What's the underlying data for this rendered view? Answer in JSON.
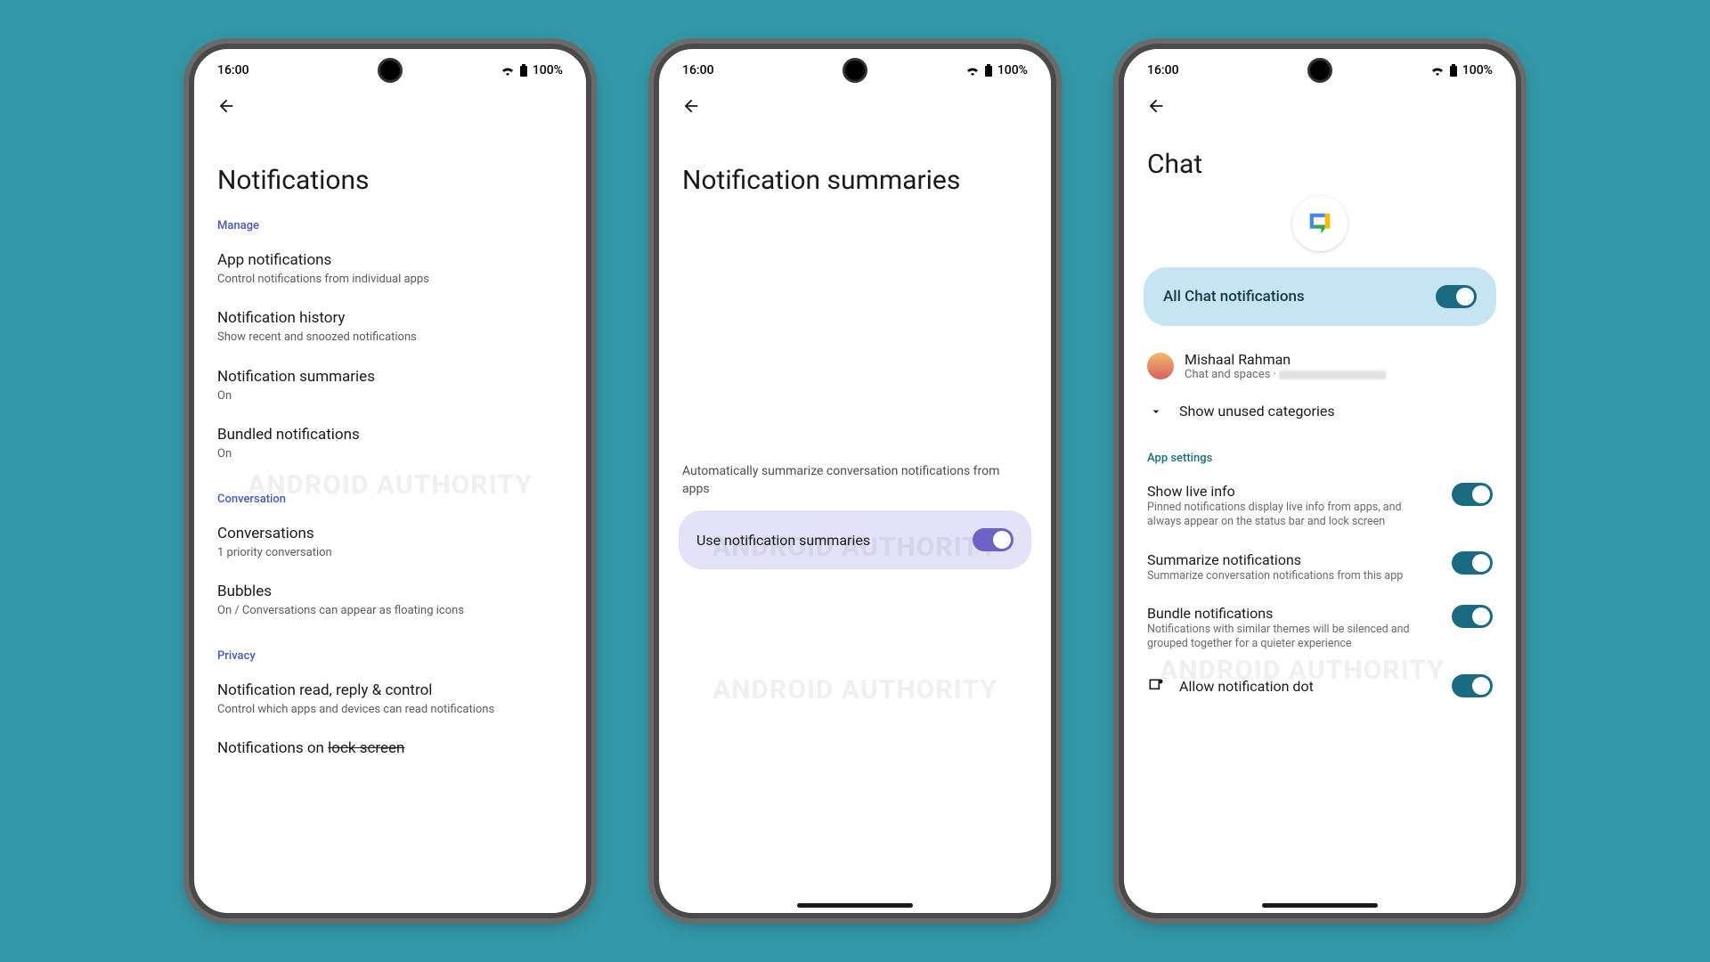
{
  "status": {
    "time": "16:00",
    "battery": "100%"
  },
  "watermark": "ANDROID AUTHORITY",
  "screen1": {
    "title": "Notifications",
    "manage_hdr": "Manage",
    "app_notif": {
      "t": "App notifications",
      "s": "Control notifications from individual apps"
    },
    "history": {
      "t": "Notification history",
      "s": "Show recent and snoozed notifications"
    },
    "summaries": {
      "t": "Notification summaries",
      "s": "On"
    },
    "bundled": {
      "t": "Bundled notifications",
      "s": "On"
    },
    "conv_hdr": "Conversation",
    "conversations": {
      "t": "Conversations",
      "s": "1 priority conversation"
    },
    "bubbles": {
      "t": "Bubbles",
      "s": "On / Conversations can appear as floating icons"
    },
    "privacy_hdr": "Privacy",
    "read_reply": {
      "t": "Notification read, reply & control",
      "s": "Control which apps and devices can read notifications"
    },
    "lockscreen_prefix": "Notifications on ",
    "lockscreen_struck": "lock screen"
  },
  "screen2": {
    "title": "Notification summaries",
    "desc": "Automatically summarize conversation notifications from apps",
    "toggle_label": "Use notification summaries",
    "toggle_on": true
  },
  "screen3": {
    "title": "Chat",
    "all_label": "All Chat notifications",
    "all_on": true,
    "user_name": "Mishaal Rahman",
    "user_sub": "Chat and spaces · ",
    "show_unused": "Show unused categories",
    "app_settings_hdr": "App settings",
    "live": {
      "t": "Show live info",
      "s": "Pinned notifications display live info from apps, and always appear on the status bar and lock screen",
      "on": true
    },
    "summarize": {
      "t": "Summarize notifications",
      "s": "Summarize conversation notifications from this app",
      "on": true
    },
    "bundle": {
      "t": "Bundle notifications",
      "s": "Notifications with similar themes will be silenced and grouped together for a quieter experience",
      "on": true
    },
    "allow_dot": {
      "t": "Allow notification dot",
      "on": true
    }
  }
}
